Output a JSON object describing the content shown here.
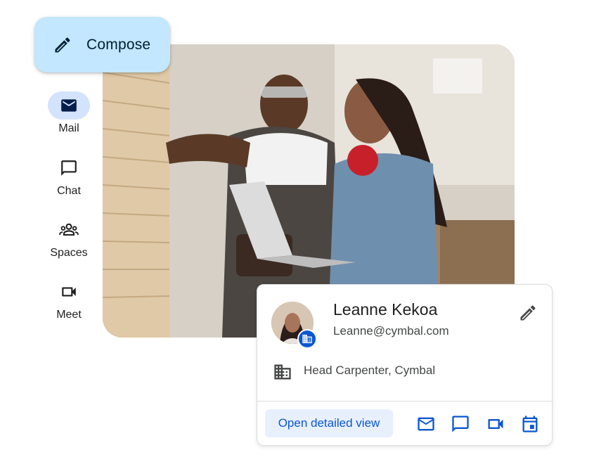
{
  "compose": {
    "label": "Compose",
    "icon": "pencil-icon"
  },
  "nav": {
    "items": [
      {
        "label": "Mail",
        "icon": "mail-icon",
        "active": true
      },
      {
        "label": "Chat",
        "icon": "chat-icon",
        "active": false
      },
      {
        "label": "Spaces",
        "icon": "spaces-icon",
        "active": false
      },
      {
        "label": "Meet",
        "icon": "video-icon",
        "active": false
      }
    ]
  },
  "contact": {
    "name": "Leanne Kekoa",
    "email": "Leanne@cymbal.com",
    "role": "Head Carpenter, Cymbal",
    "open_label": "Open detailed view",
    "actions": [
      "mail-icon",
      "chat-icon",
      "video-icon",
      "calendar-icon"
    ]
  },
  "colors": {
    "accent": "#0b57d0",
    "compose_bg": "#c2e7ff",
    "active_pill": "#d3e3fd",
    "open_btn_bg": "#e8f0fe"
  }
}
